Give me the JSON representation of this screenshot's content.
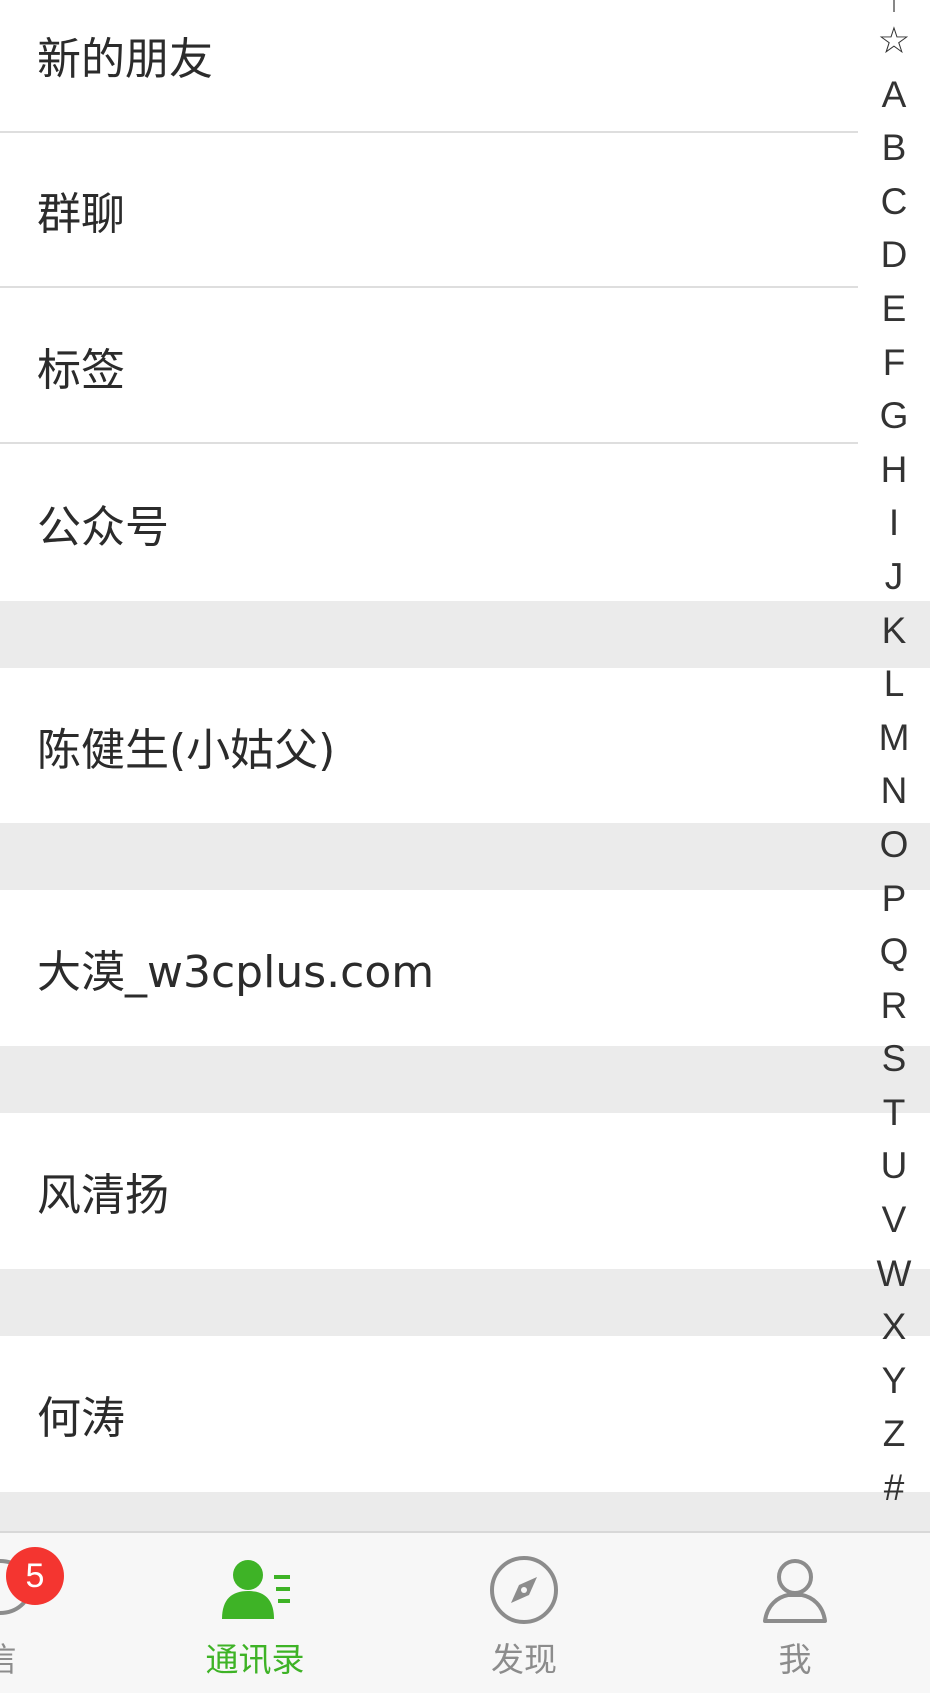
{
  "contacts": {
    "top_items": [
      {
        "label": "新的朋友"
      },
      {
        "label": "群聊"
      },
      {
        "label": "标签"
      },
      {
        "label": "公众号"
      }
    ],
    "people": [
      {
        "label": "陈健生(小姑父)"
      },
      {
        "label": "大漠_w3cplus.com"
      },
      {
        "label": "风清扬"
      },
      {
        "label": "何涛"
      }
    ]
  },
  "index_bar": {
    "letters": [
      "↑",
      "☆",
      "A",
      "B",
      "C",
      "D",
      "E",
      "F",
      "G",
      "H",
      "I",
      "J",
      "K",
      "L",
      "M",
      "N",
      "O",
      "P",
      "Q",
      "R",
      "S",
      "T",
      "U",
      "V",
      "W",
      "X",
      "Y",
      "Z",
      "#"
    ]
  },
  "tab_bar": {
    "tabs": [
      {
        "label": "信",
        "icon": "chat-bubble-icon",
        "badge": "5",
        "active": false
      },
      {
        "label": "通讯录",
        "icon": "contacts-icon",
        "active": true
      },
      {
        "label": "发现",
        "icon": "compass-icon",
        "active": false
      },
      {
        "label": "我",
        "icon": "profile-icon",
        "active": false
      }
    ]
  },
  "colors": {
    "accent": "#3eb326",
    "badge": "#f43530",
    "section_gap": "#ebebeb",
    "text": "#2b2b2b",
    "tab_inactive": "#8c8c8c"
  }
}
